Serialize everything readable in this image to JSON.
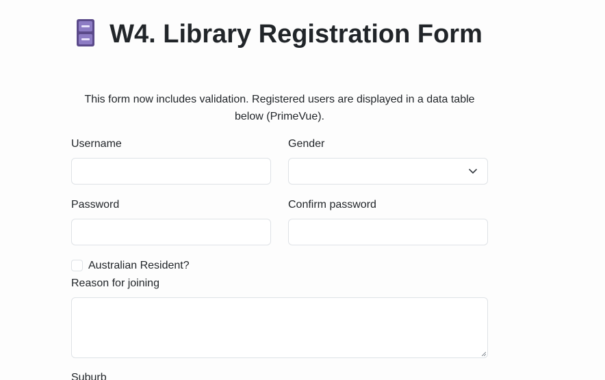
{
  "header": {
    "icon": "file-cabinet-icon",
    "title": "W4. Library Registration Form",
    "description": "This form now includes validation. Registered users are displayed in a data table below (PrimeVue)."
  },
  "form": {
    "username": {
      "label": "Username",
      "value": "",
      "placeholder": ""
    },
    "gender": {
      "label": "Gender",
      "selected": ""
    },
    "password": {
      "label": "Password",
      "value": "",
      "placeholder": ""
    },
    "confirm_password": {
      "label": "Confirm password",
      "value": "",
      "placeholder": ""
    },
    "resident": {
      "label": "Australian Resident?",
      "checked": false
    },
    "reason": {
      "label": "Reason for joining",
      "value": ""
    },
    "suburb": {
      "label": "Suburb"
    }
  },
  "colors": {
    "text": "#212529",
    "border": "#dee2e6",
    "background": "#fdfdfd",
    "icon_primary": "#5b4a8a",
    "icon_drawer": "#8d7cc4"
  }
}
